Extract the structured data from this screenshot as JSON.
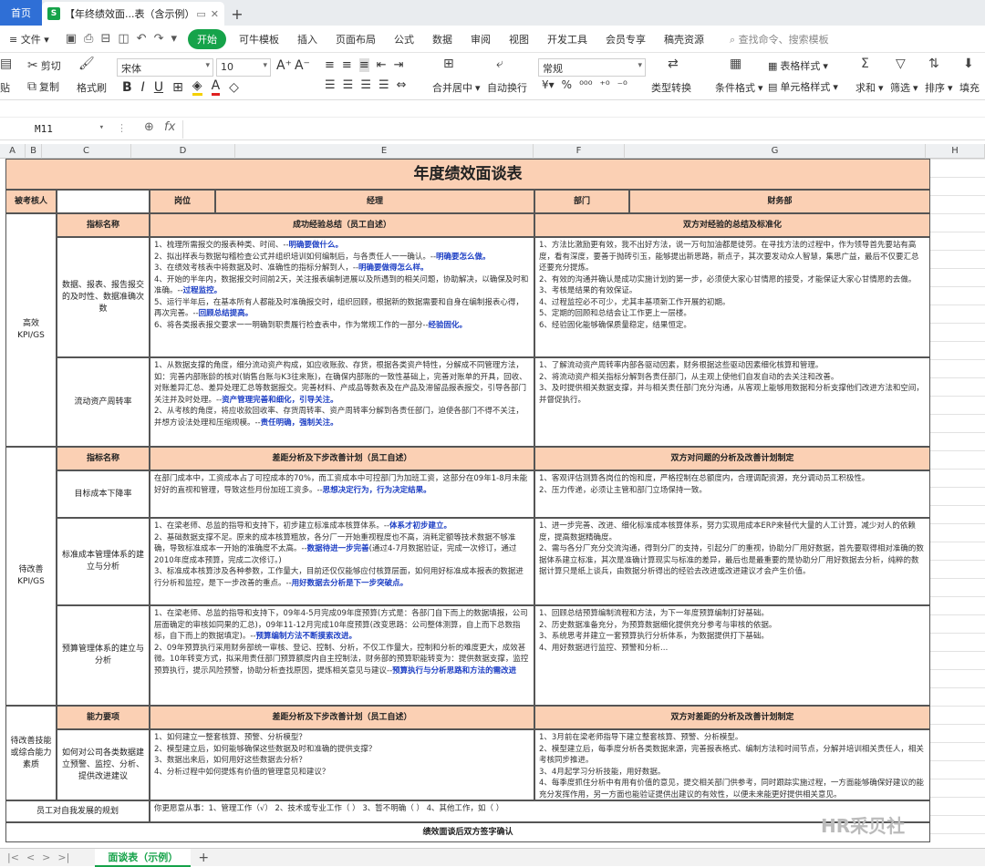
{
  "tabs": {
    "home": "首页",
    "doc_title": "【年终绩效面...表（含示例）",
    "add": "+"
  },
  "menu": {
    "file": "文件",
    "items": [
      "开始",
      "可牛模板",
      "插入",
      "页面布局",
      "公式",
      "数据",
      "审阅",
      "视图",
      "开发工具",
      "会员专享",
      "稿壳资源"
    ],
    "active_index": 0,
    "search": "查找命令、搜索模板"
  },
  "ribbon": {
    "paste": "贴",
    "cut": "剪切",
    "copy": "复制",
    "format_painter": "格式刷",
    "font": "宋体",
    "font_size": "10",
    "merge": "合并居中",
    "wrap": "自动换行",
    "number_format": "常规",
    "type_convert": "类型转换",
    "cond_format": "条件格式",
    "table_style": "表格样式",
    "cell_style": "单元格样式",
    "sum": "求和",
    "filter": "筛选",
    "sort": "排序",
    "fill": "填充"
  },
  "formula_bar": {
    "cell_ref": "M11",
    "fx": "fx",
    "value": ""
  },
  "columns": [
    "A",
    "B",
    "C",
    "D",
    "E",
    "F",
    "G",
    "H"
  ],
  "sheet": {
    "title": "年度绩效面谈表",
    "row_person": {
      "label": "被考核人",
      "position_label": "岗位",
      "position_value": "经理",
      "dept_label": "部门",
      "dept_value": "财务部"
    },
    "sec1": {
      "group": "高效KPI/GS",
      "indicator_header": "指标名称",
      "self_header": "成功经验总结（员工自述）",
      "joint_header": "双方对经验的总结及标准化",
      "rows": [
        {
          "name": "数据、报表、报告报交的及时性、数据准确次数",
          "self": [
            {
              "t": "1、梳理所需报交的报表种类、时间、--"
            },
            {
              "t": "明确要做什么。",
              "hl": true
            },
            {
              "t": "\n2、拟出样表与数据勾稽检查公式并组织培训如何编制后，与各责任人一一确认。--"
            },
            {
              "t": "明确要怎么做。",
              "hl": true
            },
            {
              "t": "\n3、在绩效考核表中将数据及时、准确性的指标分解到人，--"
            },
            {
              "t": "明确要做得怎么样。",
              "hl": true
            },
            {
              "t": "\n4、开始的半年内，数据报交时间前2天，关注报表编制进展以及所遇到的相关问题，协助解决，以确保及时和准确。--"
            },
            {
              "t": "过程监控。",
              "hl": true
            },
            {
              "t": "\n5、运行半年后，在基本所有人都能及时准确报交时，组织回顾，根据新的数据需要和自身在编制报表心得，再次完善。--"
            },
            {
              "t": "回顾总结提高。",
              "hl": true
            },
            {
              "t": "\n6、将各类报表报交要求一一明确到职责履行检查表中，作为常规工作的一部分--"
            },
            {
              "t": "经验固化。",
              "hl": true
            }
          ],
          "joint": "1、方法比激励更有效，我不出好方法，说一万句加油都是徒劳。在寻找方法的过程中，作为领导首先要站有高度，看有深度，要善于抛砖引玉，能够提出新思路，新点子，其次要发动众人智慧，集思广益，最后不仅要汇总还要充分提炼。\n2、有效的沟通并确认是成功实施计划的第一步，必须使大家心甘情愿的接受，才能保证大家心甘情愿的去做。\n3、考核是结果的有效保证。\n4、过程监控必不可少，尤其丰基项新工作开展的初期。\n5、定期的回顾和总结会让工作更上一层楼。\n6、经验固化能够确保质量稳定，结果恒定。"
        },
        {
          "name": "流动资产周转率",
          "self": [
            {
              "t": "1、从数据支撑的角度，细分流动资产构成，如应收账款、存货，根据各类资产特性，分解成不同管理方法，如：完善内部账龄的核对(销售台账与K3往来账)，在确保内部账的一致性基础上，完善对账单的开具，回收、对账差异汇总、差异处理汇总等数据报交。完善材料、产成品等数表及在产品及滞留品报表报交，引导各部门关注并及时处理。--"
            },
            {
              "t": "资产管理完善和细化，引导关注。",
              "hl": true
            },
            {
              "t": "\n2、从考核的角度，将应收款回收率、存货周转率、资产周转率分解到各责任部门，迫使各部门不得不关注，并想方设法处理和压缩规模。--"
            },
            {
              "t": "责任明确，强制关注。",
              "hl": true
            }
          ],
          "joint": "1、了解流动资产周转率内部各驱动因素，财务根据这些驱动因素细化核算和管理。\n2、将流动资产相关指标分解到各责任部门，从主观上使他们自发自动的去关注和改善。\n3、及时提供相关数据支撑，并与相关责任部门充分沟通，从客观上能够用数据和分析支撑他们改进方法和空间，并督促执行。"
        }
      ]
    },
    "sec2": {
      "group": "待改善KPI/GS",
      "indicator_header": "指标名称",
      "self_header": "差距分析及下步改善计划（员工自述）",
      "joint_header": "双方对问题的分析及改善计划制定",
      "rows": [
        {
          "name": "目标成本下降率",
          "self": [
            {
              "t": "在部门成本中，工资成本占了可控成本的70%，而工资成本中可控部门为加班工资，这部分在09年1-8月未能好好的直视和管理，导致这些月份加班工资多。--"
            },
            {
              "t": "思想决定行为，行为决定结果。",
              "hl": true
            }
          ],
          "joint": "1、客观评估测算各岗位的饱和度，严格控制在总额度内，合理调配资源，充分调动员工积极性。\n2、压力传递，必须让主管和部门立场保持一致。"
        },
        {
          "name": "标准成本管理体系的建立与分析",
          "self": [
            {
              "t": "1、在梁老师、总监的指导和支持下，初步建立标准成本核算体系。--"
            },
            {
              "t": "体系才初步建立。",
              "hl": true
            },
            {
              "t": "\n2、基础数据支撑不足。原来的成本核算粗放，各分厂一开始重视程度也不高，消耗定额等技术数据不够准确，导致标准成本一开始的准确度不太高。--"
            },
            {
              "t": "数据待进一步完善",
              "hl": true
            },
            {
              "t": "(通过4-7月数据验证，完成一次修订，通过2010年度成本预算，完成二次修订。)"
            },
            {
              "t": "\n3、标准成本核算涉及各种参数，工作量大，目前还仅仅能够应付核算层面，如何用好标准成本报表的数据进行分析和监控，是下一步改善的重点。--"
            },
            {
              "t": "用好数据去分析是下一步突破点。",
              "hl": true
            }
          ],
          "joint": "1、进一步完善、改进、细化标准成本核算体系，努力实现用成本ERP来替代大量的人工计算，减少对人的依赖度，提高数据精确度。\n2、需与各分厂充分交流沟通，得到分厂的支持，引起分厂的重视，协助分厂用好数据，首先要取得相对准确的数据体系建立标准，其次是准确计算现实与标准的差异，最后也是最重要的是协助分厂用好数据去分析，纯粹的数据计算只是纸上谈兵，由数据分析得出的经验去改进或改进建议才会产生价值。"
        },
        {
          "name": "预算管理体系的建立与分析",
          "self": [
            {
              "t": "1、在梁老师、总监的指导和支持下，09年4-5月完成09年度预算(方式是：各部门自下而上的数据填报，公司层面确定的审核如同果的汇总)，09年11-12月完成10年度预算(改变思路：公司整体测算，自上而下总数指标，自下而上的数据填定)。--"
            },
            {
              "t": "预算编制方法不断摸索改进。",
              "hl": true
            },
            {
              "t": "\n2、09年预算执行采用财务部统一审核、登记、控制、分析，不仅工作量大，控制和分析的难度更大，成效甚微。10年转变方式，拟采用责任部门预算额度内自主控制法，财务部的预算职能转变为：提供数据支撑，监控预算执行，提示风险预警，协助分析查找原因，提炼相关意见与建议--"
            },
            {
              "t": "预算执行与分析思路和方法的需改进",
              "hl": true
            }
          ],
          "joint": "1、回顾总结预算编制流程和方法，为下一年度预算编制打好基础。\n2、历史数据准备充分，为预算数据细化提供充分参考与审核的依据。\n3、系统思考并建立一套预算执行分析体系，为数据提供打下基础。\n4、用好数据进行监控、预警和分析…"
        }
      ]
    },
    "sec3": {
      "group": "待改善技能或综合能力素质",
      "indicator_header": "能力要项",
      "self_header": "差距分析及下步改善计划（员工自述）",
      "joint_header": "双方对差距的分析及改善计划制定",
      "rows": [
        {
          "name": "如何对公司各类数据建立预警、监控、分析、提供改进建议",
          "self": [
            {
              "t": "1、如何建立一整套核算、预警、分析模型？\n2、模型建立后，如何能够确保这些数据及时和准确的提供支撑？\n3、数据出来后，如何用好这些数据去分析？\n4、分析过程中如何提炼有价值的管理意见和建议？"
            }
          ],
          "joint": "1、3月前在梁老师指导下建立整套核算、预警、分析模型。\n2、模型建立后，每季度分析各类数据来源，完善报表格式、编制方法和时间节点，分解并培训相关责任人，相关考核同步推进。\n3、4月起学习分析技能，用好数据。\n4、每季度抓住分析中有用有价值的意见，提交相关部门供参考，同时跟踪实施过程，一方面能够确保好建议的能充分发挥作用，另一方面也能验证提供出建议的有效性，以便未来能更好提供相关意见。"
        }
      ]
    },
    "plan_label": "员工对自我发展的规划",
    "plan_value": "你更愿意从事：1、管理工作（√）   2、技术或专业工作（  ）   3、暂不明确（  ）   4、其他工作，如（            ）",
    "confirm_label": "绩效面谈后双方签字确认"
  },
  "bottom": {
    "sheet_tab": "面谈表（示例）",
    "add": "+"
  },
  "watermark": "HR采贝社",
  "colors": {
    "header_fill": "#fbd0b4",
    "accent": "#16a34a",
    "home_tab": "#2f6fd6",
    "highlight_text": "#1d3fc4"
  }
}
